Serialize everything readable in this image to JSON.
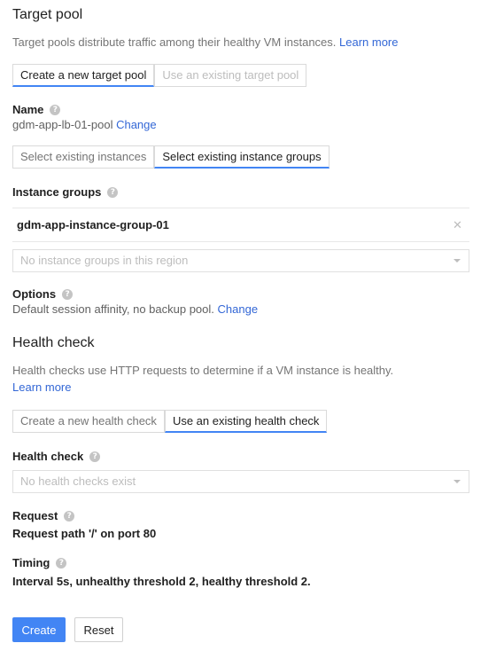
{
  "target_pool": {
    "heading": "Target pool",
    "description": "Target pools distribute traffic among their healthy VM instances.",
    "learn_more": "Learn more",
    "tabs": [
      "Create a new target pool",
      "Use an existing target pool"
    ],
    "name_label": "Name",
    "name_value": "gdm-app-lb-01-pool",
    "name_change": "Change",
    "instance_tabs": [
      "Select existing instances",
      "Select existing instance groups"
    ],
    "instance_groups_label": "Instance groups",
    "instance_group_item": "gdm-app-instance-group-01",
    "instance_group_select_placeholder": "No instance groups in this region",
    "options_label": "Options",
    "options_value": "Default session affinity, no backup pool.",
    "options_change": "Change"
  },
  "health_check": {
    "heading": "Health check",
    "description": "Health checks use HTTP requests to determine if a VM instance is healthy.",
    "learn_more": "Learn more",
    "tabs": [
      "Create a new health check",
      "Use an existing health check"
    ],
    "field_label": "Health check",
    "select_placeholder": "No health checks exist",
    "request_label": "Request",
    "request_value": "Request path '/' on port 80",
    "timing_label": "Timing",
    "timing_value": "Interval 5s, unhealthy threshold 2, healthy threshold 2."
  },
  "actions": {
    "create": "Create",
    "reset": "Reset"
  },
  "colors": {
    "accent": "#4285f4",
    "link": "#3367d6"
  },
  "icons": {
    "help": "help-circle-icon",
    "remove": "remove-x-icon",
    "dropdown": "chevron-down-icon"
  }
}
